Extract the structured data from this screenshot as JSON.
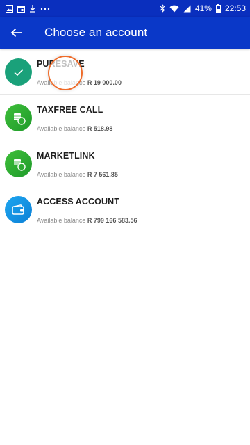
{
  "status_bar": {
    "battery": "41%",
    "time": "22:53",
    "icons": [
      "gallery-icon",
      "calendar-icon",
      "download-icon",
      "more-icon",
      "bluetooth-icon",
      "wifi-icon",
      "signal-icon",
      "battery-icon"
    ]
  },
  "header": {
    "title": "Choose an account",
    "back_icon": "back-arrow-icon"
  },
  "accounts": [
    {
      "name": "PURESAVE",
      "balance_label": "Available balance",
      "balance_value": "R 19 000.00",
      "icon": "check-icon",
      "color": "#1aa17a",
      "selected": true
    },
    {
      "name": "TAXFREE CALL",
      "balance_label": "Available balance",
      "balance_value": "R 518.98",
      "icon": "coins-icon",
      "color": "#2eab33",
      "selected": false
    },
    {
      "name": "MARKETLINK",
      "balance_label": "Available balance",
      "balance_value": "R 7 561.85",
      "icon": "coins-icon",
      "color": "#2eab33",
      "selected": false
    },
    {
      "name": "ACCESS ACCOUNT",
      "balance_label": "Available balance",
      "balance_value": "R 799 166 583.56",
      "icon": "wallet-icon",
      "color": "#1396e6",
      "selected": false
    }
  ],
  "colors": {
    "app_bar": "#0a38c8",
    "status_bar": "#0a2fbe",
    "touch_ring": "#ef6c2a"
  }
}
